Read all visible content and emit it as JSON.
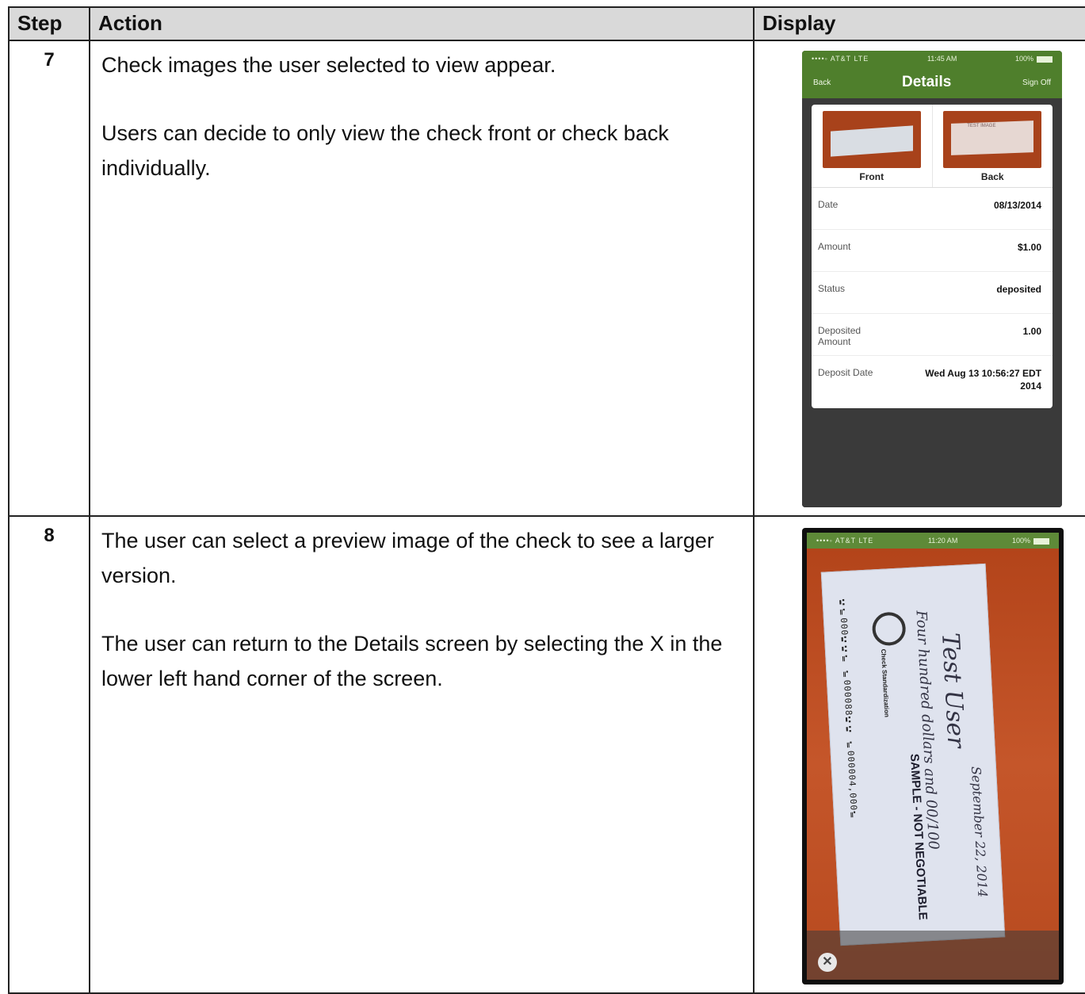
{
  "table": {
    "headers": {
      "step": "Step",
      "action": "Action",
      "display": "Display"
    },
    "rows": [
      {
        "step": "7",
        "paragraphs": [
          "Check images the user selected to view appear.",
          "Users can decide to only view the check front or check back individually."
        ]
      },
      {
        "step": "8",
        "paragraphs": [
          "The user can select a preview image of the check to see a larger version.",
          "The user can return to the Details screen by selecting the X in the lower left hand corner of the screen."
        ]
      }
    ]
  },
  "screen1": {
    "status": {
      "carrier": "••••◦ AT&T  LTE",
      "time": "11:45 AM",
      "battery": "100%"
    },
    "nav": {
      "back": "Back",
      "title": "Details",
      "signoff": "Sign Off"
    },
    "thumb_back_text": "TEST IMAGE",
    "thumbs": {
      "front": "Front",
      "back": "Back"
    },
    "details": [
      {
        "label": "Date",
        "value": "08/13/2014"
      },
      {
        "label": "Amount",
        "value": "$1.00"
      },
      {
        "label": "Status",
        "value": "deposited"
      },
      {
        "label": "Deposited Amount",
        "value": "1.00"
      },
      {
        "label": "Deposit Date",
        "value": "Wed Aug 13 10:56:27 EDT 2014"
      }
    ],
    "colors": {
      "accent": "#4f7f2c",
      "background": "#3a3a3a"
    }
  },
  "screen2": {
    "status": {
      "carrier": "••••◦ AT&T  LTE",
      "time": "11:20 AM",
      "battery": "100%"
    },
    "check": {
      "payee": "Test User",
      "amount_words": "Four hundred dollars and 00/100",
      "date": "September 22, 2014",
      "sample_text": "SAMPLE - NOT NEGOTIABLE",
      "micr": "⑆⑈000⑆⑆⑈ ⑈000088⑆⑆ ⑈000004,000⑈",
      "bank": "Check Standardization"
    },
    "close": "✕"
  }
}
